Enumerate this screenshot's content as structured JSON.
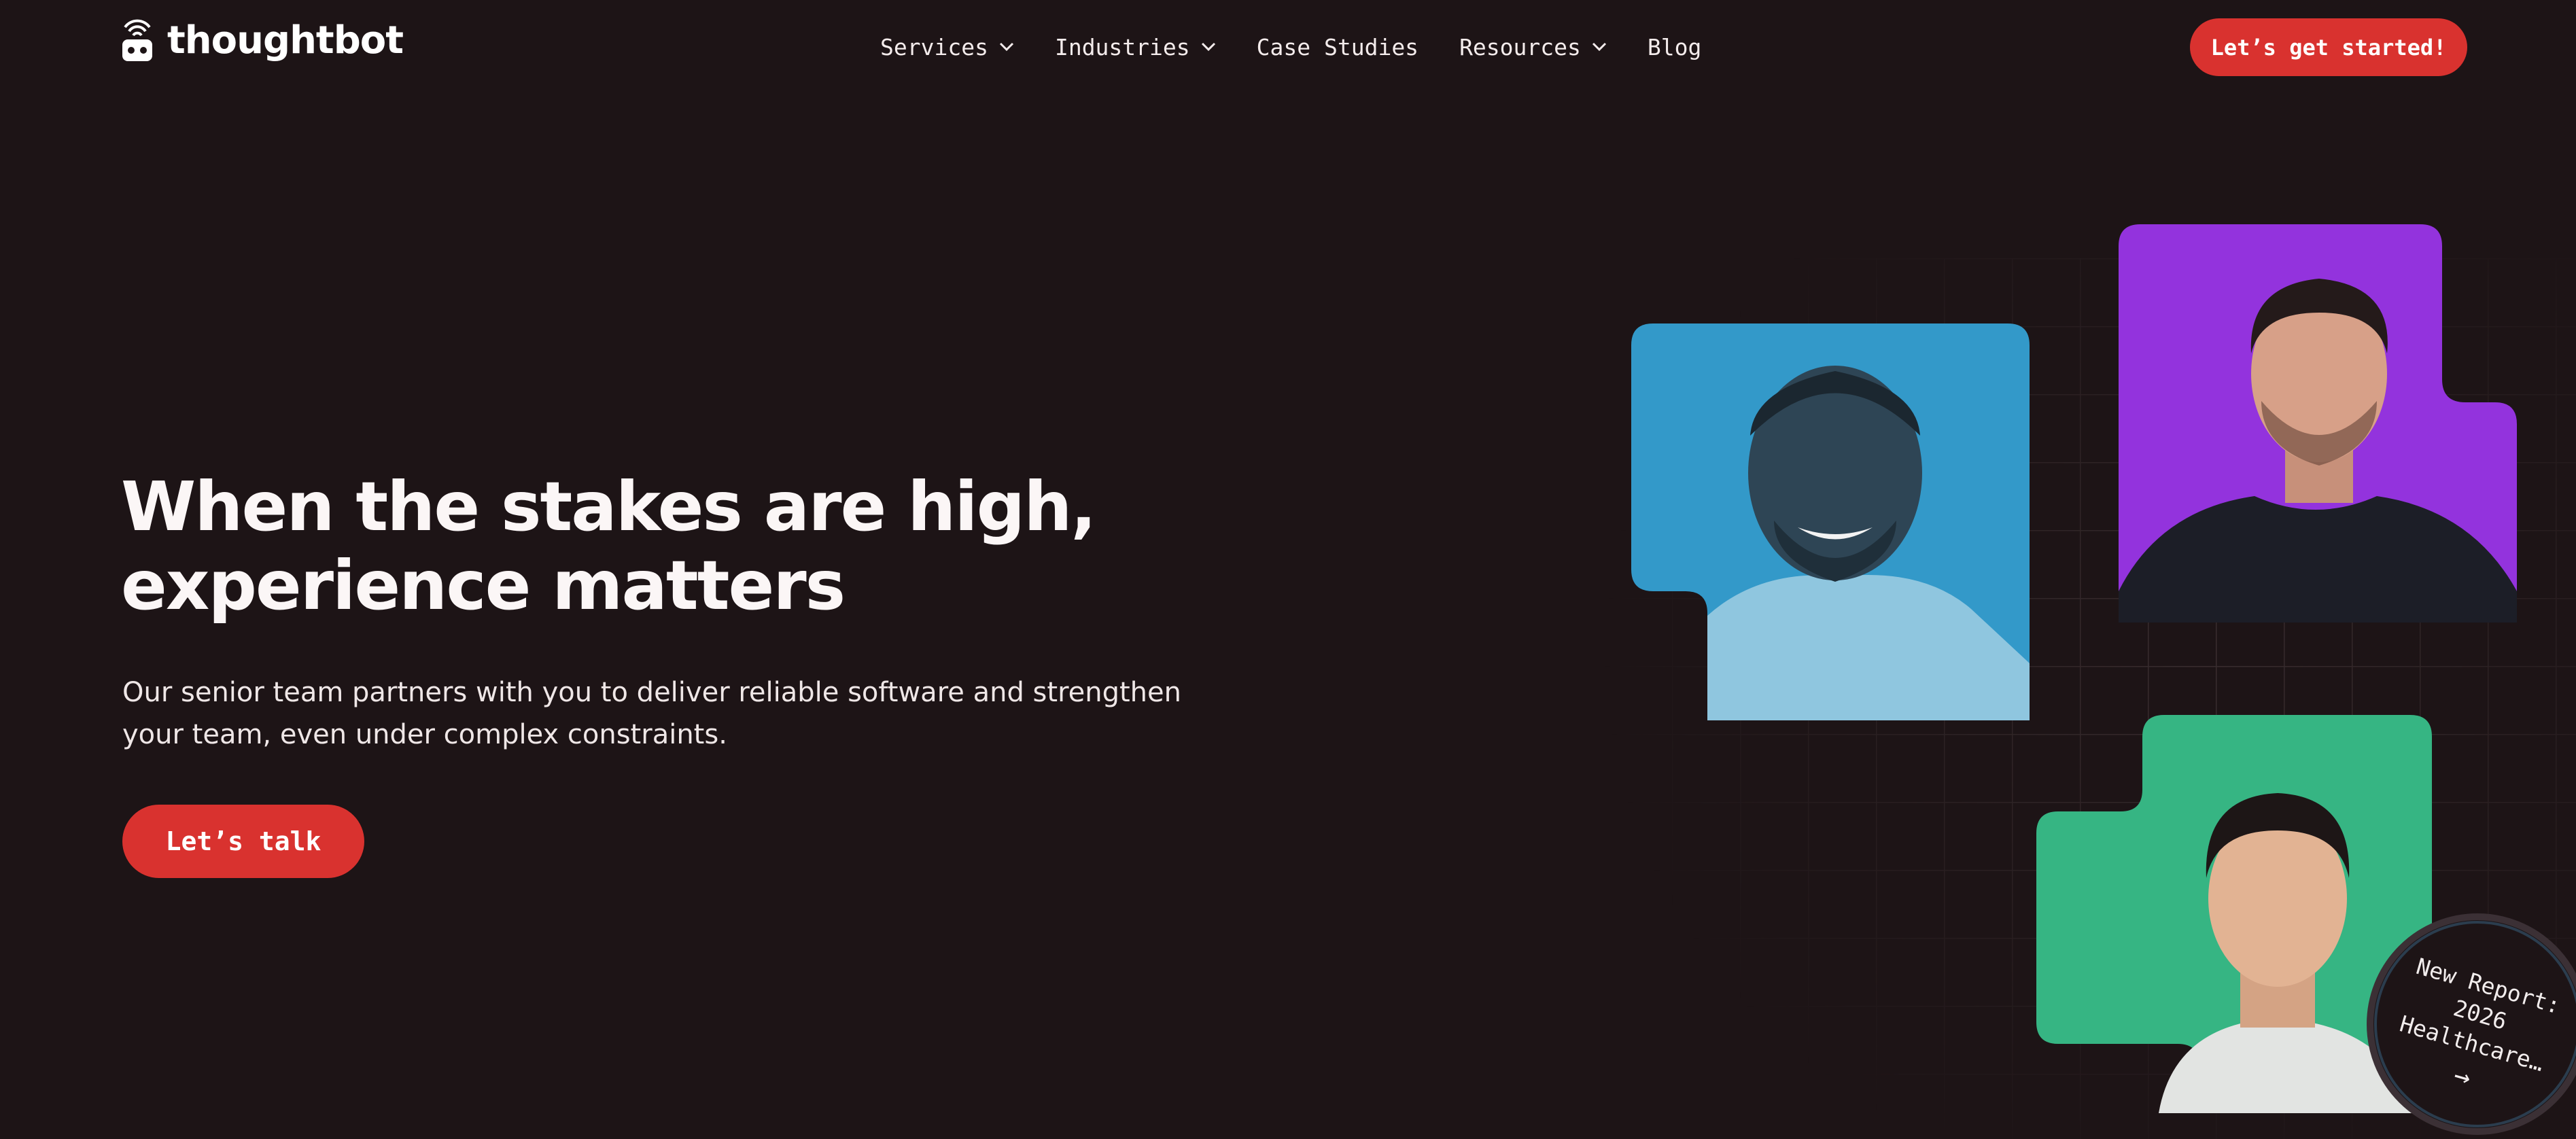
{
  "header": {
    "brand": "thoughtbot",
    "nav": [
      {
        "label": "Services",
        "has_dropdown": true
      },
      {
        "label": "Industries",
        "has_dropdown": true
      },
      {
        "label": "Case Studies",
        "has_dropdown": false
      },
      {
        "label": "Resources",
        "has_dropdown": true
      },
      {
        "label": "Blog",
        "has_dropdown": false
      }
    ],
    "cta_label": "Let’s get started!"
  },
  "hero": {
    "headline": "When the stakes are high, experience matters",
    "subtext": "Our senior team partners with you to deliver reliable software and strengthen your team, even under complex constraints.",
    "cta_label": "Let’s talk"
  },
  "badge": {
    "line1": "New Report:",
    "line2": "2026",
    "line3": "Healthcare…",
    "arrow": "→"
  },
  "colors": {
    "background": "#1d1416",
    "accent": "#d9322f",
    "portrait_blue": "#3399c9",
    "portrait_purple": "#9333dd",
    "portrait_green": "#36b583"
  },
  "icons": [
    "thoughtbot-logo-icon",
    "chevron-down-icon",
    "arrow-right-icon"
  ]
}
